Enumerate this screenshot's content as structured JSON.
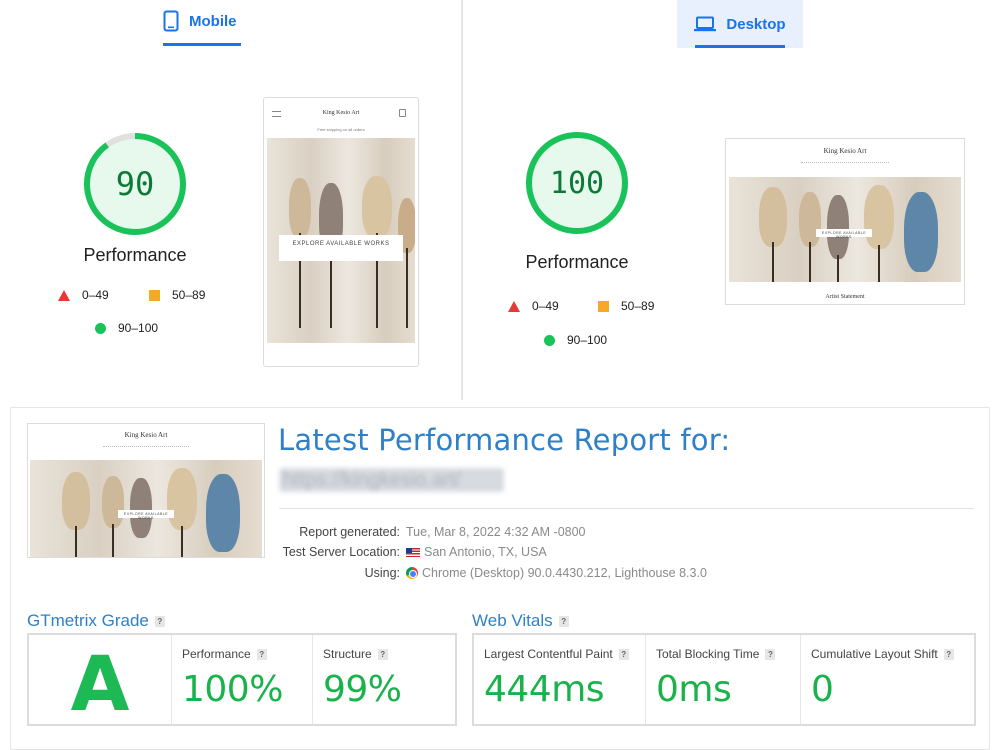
{
  "lighthouse": {
    "mobile": {
      "tab_label": "Mobile",
      "score": "90",
      "score_value": 90,
      "score_label": "Performance",
      "legend": {
        "poor": "0–49",
        "average": "50–89",
        "good": "90–100"
      },
      "preview": {
        "site_title": "King Kesio Art",
        "banner": "Free shipping on all orders",
        "cta": "EXPLORE AVAILABLE WORKS"
      }
    },
    "desktop": {
      "tab_label": "Desktop",
      "score": "100",
      "score_value": 100,
      "score_label": "Performance",
      "legend": {
        "poor": "0–49",
        "average": "50–89",
        "good": "90–100"
      },
      "preview": {
        "site_title": "King Kesio Art",
        "cta": "EXPLORE AVAILABLE WORKS",
        "footer": "Artist Statement"
      }
    },
    "colors": {
      "good": "#19c35a",
      "average": "#f7a829",
      "poor": "#e53935",
      "tab_accent": "#1a73e8"
    }
  },
  "gtmetrix": {
    "heading": "Latest Performance Report for:",
    "url": "https://kingkesio.art/",
    "thumbnail": {
      "site_title": "King Kesio Art",
      "cta": "EXPLORE AVAILABLE WORKS"
    },
    "meta": {
      "generated_key": "Report generated:",
      "generated_val": "Tue, Mar 8, 2022 4:32 AM -0800",
      "location_key": "Test Server Location:",
      "location_val": "San Antonio, TX, USA",
      "using_key": "Using:",
      "using_val": "Chrome (Desktop) 90.0.4430.212, Lighthouse 8.3.0"
    },
    "grade": {
      "title": "GTmetrix Grade",
      "help": "?",
      "letter": "A",
      "performance_label": "Performance",
      "performance_value": "100%",
      "structure_label": "Structure",
      "structure_value": "99%"
    },
    "web_vitals": {
      "title": "Web Vitals",
      "help": "?",
      "lcp_label": "Largest Contentful Paint",
      "lcp_value": "444ms",
      "tbt_label": "Total Blocking Time",
      "tbt_value": "0ms",
      "cls_label": "Cumulative Layout Shift",
      "cls_value": "0"
    },
    "colors": {
      "heading": "#2f80c7",
      "value": "#19b24b",
      "grade": "#1db954"
    }
  }
}
